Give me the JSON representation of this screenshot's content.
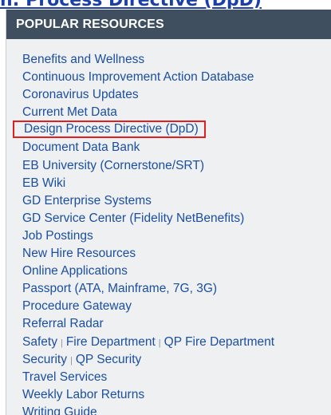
{
  "page_link": {
    "text": "n: Process Directive (DpD)"
  },
  "panel": {
    "title": "POPULAR RESOURCES",
    "highlighted_index": 4,
    "separator": "|",
    "items": [
      {
        "label": "Benefits and Wellness"
      },
      {
        "label": "Continuous Improvement Action Database"
      },
      {
        "label": "Coronavirus Updates"
      },
      {
        "label": "Current Met Data"
      },
      {
        "label": "Design Process Directive (DpD)"
      },
      {
        "label": "Document Data Bank"
      },
      {
        "label": "EB University (Cornerstone/SRT)"
      },
      {
        "label": "EB Wiki"
      },
      {
        "label": "GD Enterprise Systems"
      },
      {
        "label": "GD Service Center (Fidelity NetBenefits)"
      },
      {
        "label": "Job Postings"
      },
      {
        "label": "New Hire Resources"
      },
      {
        "label": "Online Applications"
      },
      {
        "label": "Passport (ATA, Mainframe, 7G, 3G)"
      },
      {
        "label": "Procedure Gateway"
      },
      {
        "label": "Referral Radar"
      },
      {
        "parts": [
          "Safety",
          "Fire Department",
          "QP Fire Department"
        ]
      },
      {
        "parts": [
          "Security",
          "QP Security"
        ]
      },
      {
        "label": "Travel Services"
      },
      {
        "label": "Weekly Labor Returns"
      },
      {
        "label": "Writing Guide"
      }
    ]
  }
}
